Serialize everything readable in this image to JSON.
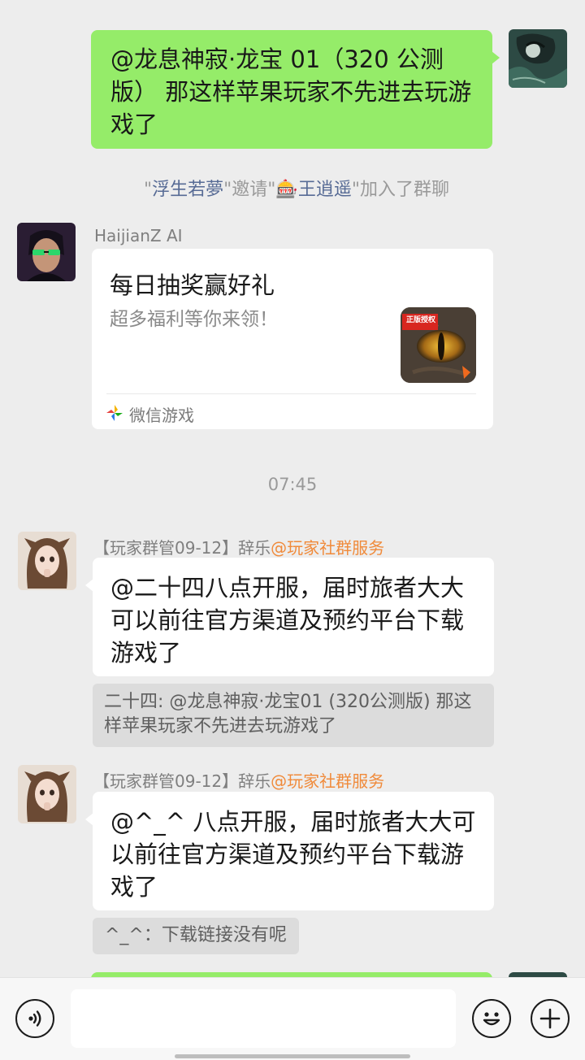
{
  "messages": {
    "m1": {
      "text": "@龙息神寂·龙宝 01（320 公测版） 那这样苹果玩家不先进去玩游戏了"
    },
    "system_invite": {
      "q1": "\"",
      "inviter": "浮生若夢",
      "mid": "\"邀请\"",
      "emoji": "🎰",
      "invitee": "王逍遥",
      "end": "\"加入了群聊"
    },
    "card": {
      "sender": "HaijianZ AI",
      "title": "每日抽奖赢好礼",
      "subtitle": "超多福利等你来领！",
      "thumb_badge": "正版授权",
      "source": "微信游戏"
    },
    "time": "07:45",
    "m2": {
      "sender_prefix": "【玩家群管09-12】辞乐",
      "sender_tag": "@玩家社群服务",
      "text": "@二十四八点开服，届时旅者大大可以前往官方渠道及预约平台下载游戏了",
      "quote": "二十四: @龙息神寂·龙宝01 (320公测版) 那这样苹果玩家不先进去玩游戏了"
    },
    "m3": {
      "sender_prefix": "【玩家群管09-12】辞乐",
      "sender_tag": "@玩家社群服务",
      "text": "@^_^ 八点开服，届时旅者大大可以前往官方渠道及预约平台下载游戏了",
      "quote": "^_^：下载链接没有呢"
    }
  },
  "input": {
    "placeholder": ""
  },
  "colors": {
    "green_bubble": "#95ec69",
    "link_blue": "#576b95",
    "tag_orange": "#f08a3a"
  }
}
